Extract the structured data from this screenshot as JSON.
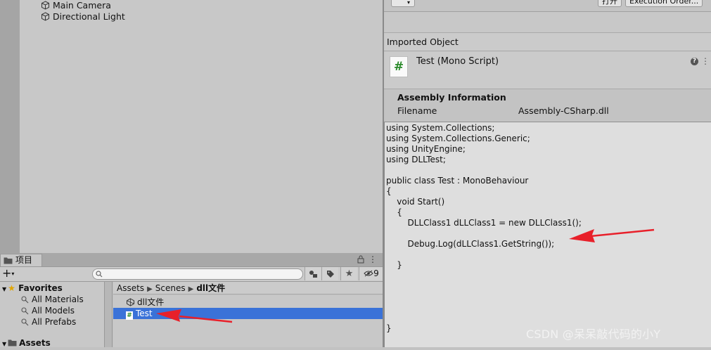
{
  "hierarchy": {
    "items": [
      {
        "label": "Main Camera"
      },
      {
        "label": "Directional Light"
      }
    ]
  },
  "project": {
    "tab_label": "项目",
    "toolbar": {
      "add_label": "+",
      "search_placeholder": "",
      "hidden_count": "9"
    },
    "favorites": {
      "title": "Favorites",
      "items": [
        {
          "label": "All Materials"
        },
        {
          "label": "All Models"
        },
        {
          "label": "All Prefabs"
        }
      ]
    },
    "assets_root": "Assets",
    "breadcrumb": [
      "Assets",
      "Scenes",
      "dll文件"
    ],
    "assets": [
      {
        "label": "dll文件",
        "icon": "unity-icon"
      },
      {
        "label": "Test",
        "icon": "csharp-script-icon"
      }
    ]
  },
  "inspector": {
    "top_buttons": [
      "打开",
      "Execution Order..."
    ],
    "imported_object_label": "Imported Object",
    "object_title": "Test (Mono Script)",
    "script_icon_glyph": "#",
    "assembly": {
      "title": "Assembly Information",
      "filename_label": "Filename",
      "filename_value": "Assembly-CSharp.dll"
    },
    "code_lines": [
      "using System.Collections;",
      "using System.Collections.Generic;",
      "using UnityEngine;",
      "using DLLTest;",
      "",
      "public class Test : MonoBehaviour",
      "{",
      "    void Start()",
      "    {",
      "        DLLClass1 dLLClass1 = new DLLClass1();",
      "",
      "        Debug.Log(dLLClass1.GetString());",
      "",
      "    }",
      "",
      "",
      "",
      "",
      "",
      "}"
    ]
  },
  "watermark": "CSDN @呆呆敲代码的小Y",
  "colors": {
    "selection": "#3a72d8",
    "arrow": "#e8202a",
    "script_hash": "#2a8a2a",
    "favorite_star": "#e0a500"
  }
}
